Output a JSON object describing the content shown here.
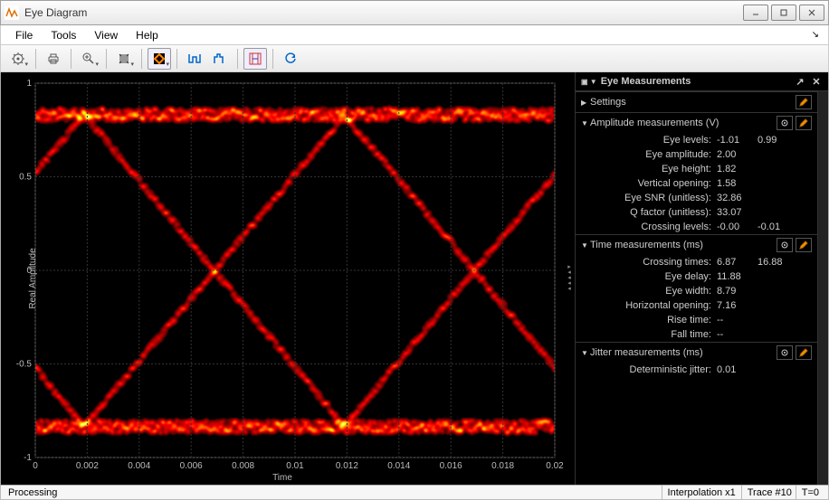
{
  "window": {
    "title": "Eye Diagram"
  },
  "menus": [
    "File",
    "Tools",
    "View",
    "Help"
  ],
  "plot": {
    "ylabel": "Real Amplitude",
    "xlabel": "Time",
    "yticks": [
      "1",
      "0.5",
      "0",
      "-0.5",
      "-1"
    ],
    "xticks": [
      "0",
      "0.002",
      "0.004",
      "0.006",
      "0.008",
      "0.01",
      "0.012",
      "0.014",
      "0.016",
      "0.018",
      "0.02"
    ]
  },
  "measurements": {
    "title": "Eye Measurements",
    "settings_label": "Settings",
    "amp_section": "Amplitude measurements (V)",
    "time_section": "Time measurements (ms)",
    "jitter_section": "Jitter measurements (ms)",
    "amp": {
      "eye_levels_label": "Eye levels:",
      "eye_levels_1": "-1.01",
      "eye_levels_2": "0.99",
      "eye_amp_label": "Eye amplitude:",
      "eye_amp": "2.00",
      "eye_height_label": "Eye height:",
      "eye_height": "1.82",
      "vopen_label": "Vertical opening:",
      "vopen": "1.58",
      "snr_label": "Eye SNR (unitless):",
      "snr": "32.86",
      "q_label": "Q factor (unitless):",
      "q": "33.07",
      "cross_label": "Crossing levels:",
      "cross_1": "-0.00",
      "cross_2": "-0.01"
    },
    "time": {
      "cross_label": "Crossing times:",
      "cross_1": "6.87",
      "cross_2": "16.88",
      "delay_label": "Eye delay:",
      "delay": "11.88",
      "width_label": "Eye width:",
      "width": "8.79",
      "hopen_label": "Horizontal opening:",
      "hopen": "7.16",
      "rise_label": "Rise time:",
      "rise": "--",
      "fall_label": "Fall time:",
      "fall": "--"
    },
    "jitter": {
      "det_label": "Deterministic jitter:",
      "det": "0.01"
    }
  },
  "status": {
    "left": "Processing",
    "interp": "Interpolation x1",
    "trace": "Trace #10",
    "t": "T=0"
  },
  "chart_data": {
    "type": "heatmap",
    "title": "Eye Diagram",
    "xlabel": "Time",
    "ylabel": "Real Amplitude",
    "xlim": [
      0,
      0.02
    ],
    "ylim": [
      -1.2,
      1.2
    ],
    "levels": [
      -1,
      1
    ],
    "crossings_x": [
      0.00687,
      0.01688
    ],
    "trace_density": "hot colormap, band ~0.1 wide around levels, X transitions between crossings"
  }
}
